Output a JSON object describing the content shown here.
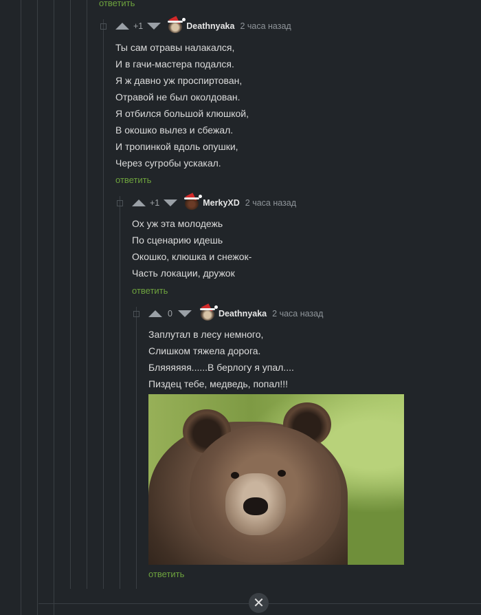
{
  "top_reply": "ответить",
  "comments": [
    {
      "rating": "+1",
      "author": "Deathnyaka",
      "time": "2 часа назад",
      "lines": [
        "Ты сам отравы налакался,",
        "И в гачи-мастера подался.",
        "Я ж давно уж проспиртован,",
        "Отравой не был околдован.",
        "Я отбился большой клюшкой,",
        "В окошко вылез и сбежал.",
        "И тропинкой вдоль опушки,",
        "Через сугробы ускакал."
      ],
      "reply": "ответить"
    },
    {
      "rating": "+1",
      "author": "MerkyXD",
      "time": "2 часа назад",
      "lines": [
        "Ох уж эта молодежь",
        "По сценарию идешь",
        "Окошко, клюшка и снежок-",
        "Часть локации, дружок"
      ],
      "reply": "ответить"
    },
    {
      "rating": "0",
      "author": "Deathnyaka",
      "time": "2 часа назад",
      "lines": [
        "Заплутал в лесу немного,",
        "Слишком тяжела дорога.",
        "Бляяяяяя......В берлогу я упал....",
        "Пиздец тебе, медведь, попал!!!"
      ],
      "reply": "ответить"
    }
  ],
  "close_symbol": "✕",
  "icons": {
    "collapse": "collapse-icon",
    "upvote": "arrow-up-icon",
    "downvote": "arrow-down-icon",
    "close": "close-icon"
  },
  "colors": {
    "background": "#212529",
    "reply": "#6ea33e",
    "text": "#dcdcdc"
  }
}
